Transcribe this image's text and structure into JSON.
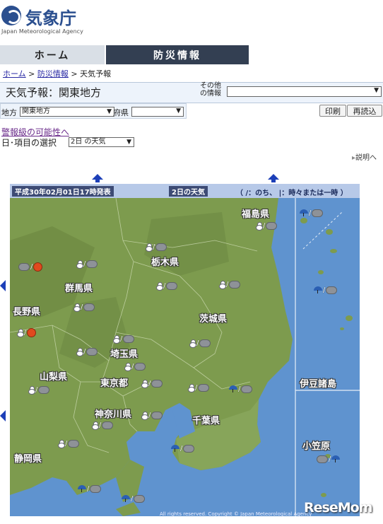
{
  "agency": {
    "name_jp": "気象庁",
    "name_en": "Japan Meteorological Agency"
  },
  "nav": {
    "home": "ホーム",
    "disaster": "防災情報"
  },
  "breadcrumb": {
    "home": "ホーム",
    "disaster": "防災情報",
    "current": "天気予報"
  },
  "page": {
    "title": "天気予報：関東地方"
  },
  "other_info": {
    "label": "その他の情報",
    "value": ""
  },
  "filters": {
    "region_label": "地方",
    "region_value": "関東地方",
    "pref_label": "府県",
    "pref_value": ""
  },
  "buttons": {
    "print": "印刷",
    "reload": "再読込"
  },
  "links": {
    "warning": "警報級の可能性へ",
    "explain": "説明へ"
  },
  "day_select": {
    "label": "日･項目の選択",
    "value": "2日 の天気"
  },
  "map_header": {
    "issued": "平成30年02月01日17時発表",
    "day_weather": "2日の天気",
    "legend_note": "（ /：のち、 |：時々または一時 ）"
  },
  "prefectures": [
    "福島県",
    "栃木県",
    "群馬県",
    "長野県",
    "茨城県",
    "埼玉県",
    "山梨県",
    "東京都",
    "神奈川県",
    "千葉県",
    "静岡県",
    "伊豆諸島",
    "小笠原"
  ],
  "forecast_icons": {
    "snow": "snowman-icon",
    "cloud": "cloud-icon",
    "sun": "sun-icon",
    "rain": "umbrella-icon"
  },
  "copyright": "All rights reserved. Copyright © Japan Meteorological Agency",
  "watermark": "ReseMom",
  "colors": {
    "nav_active": "#333f52",
    "sea": "#5f93cf",
    "land": "#7a9a4a"
  }
}
